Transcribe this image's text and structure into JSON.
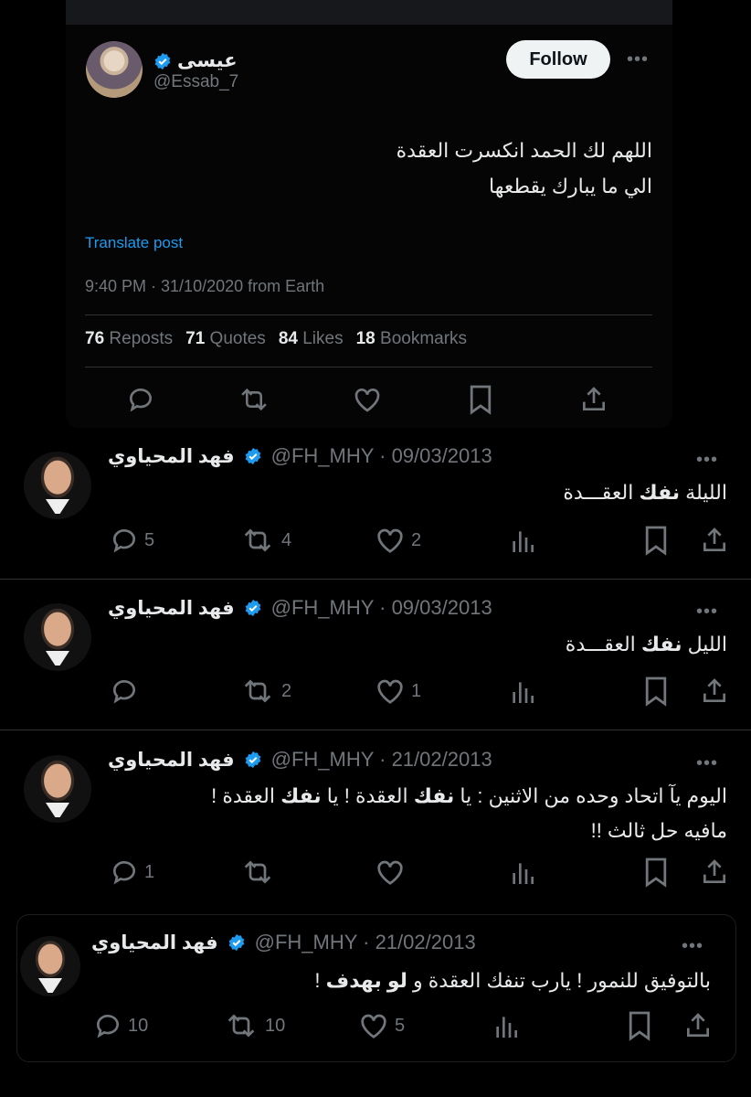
{
  "main_tweet": {
    "author_name": "عيسى",
    "author_handle": "@Essab_7",
    "follow_label": "Follow",
    "more_label": "•••",
    "text_line1": "اللهم لك الحمد انكسرت العقدة",
    "text_line2": "الي ما يبارك يقطعها",
    "translate_label": "Translate post",
    "timestamp": "9:40 PM · 31/10/2020 from Earth",
    "stats": [
      {
        "value": "76",
        "label": "Reposts"
      },
      {
        "value": "71",
        "label": "Quotes"
      },
      {
        "value": "84",
        "label": "Likes"
      },
      {
        "value": "18",
        "label": "Bookmarks"
      }
    ]
  },
  "replies": [
    {
      "author_name": "فهد المحياوي",
      "meta": "@FH_MHY · 09/03/2013",
      "text_pre": "الليلة ",
      "text_bold": "نفك",
      "text_post": " العقـــدة",
      "replies": "5",
      "reposts": "4",
      "likes": "2"
    },
    {
      "author_name": "فهد المحياوي",
      "meta": "@FH_MHY · 09/03/2013",
      "text_pre": "الليل ",
      "text_bold": "نفك",
      "text_post": " العقـــدة",
      "replies": "",
      "reposts": "2",
      "likes": "1"
    },
    {
      "author_name": "فهد المحياوي",
      "meta": "@FH_MHY · 21/02/2013",
      "line1_pre": "اليوم يآ اتحاد وحده من الاثنين : يا ",
      "line1_b1": "نفك",
      "line1_mid": " العقدة ! يا ",
      "line1_b2": "نفك",
      "line1_post": " العقدة !",
      "line2": "مافيه حل ثالث !!",
      "replies": "1",
      "reposts": "",
      "likes": ""
    },
    {
      "author_name": "فهد المحياوي",
      "meta": "@FH_MHY · 21/02/2013",
      "text_pre": "بالتوفيق للنمور ! يارب تنفك العقدة و ",
      "text_bold": "لو بهدف",
      "text_post": " !",
      "replies": "10",
      "reposts": "10",
      "likes": "5"
    }
  ],
  "colors": {
    "accent": "#1d9bf0",
    "muted": "#71767b",
    "text": "#e7e9ea"
  }
}
